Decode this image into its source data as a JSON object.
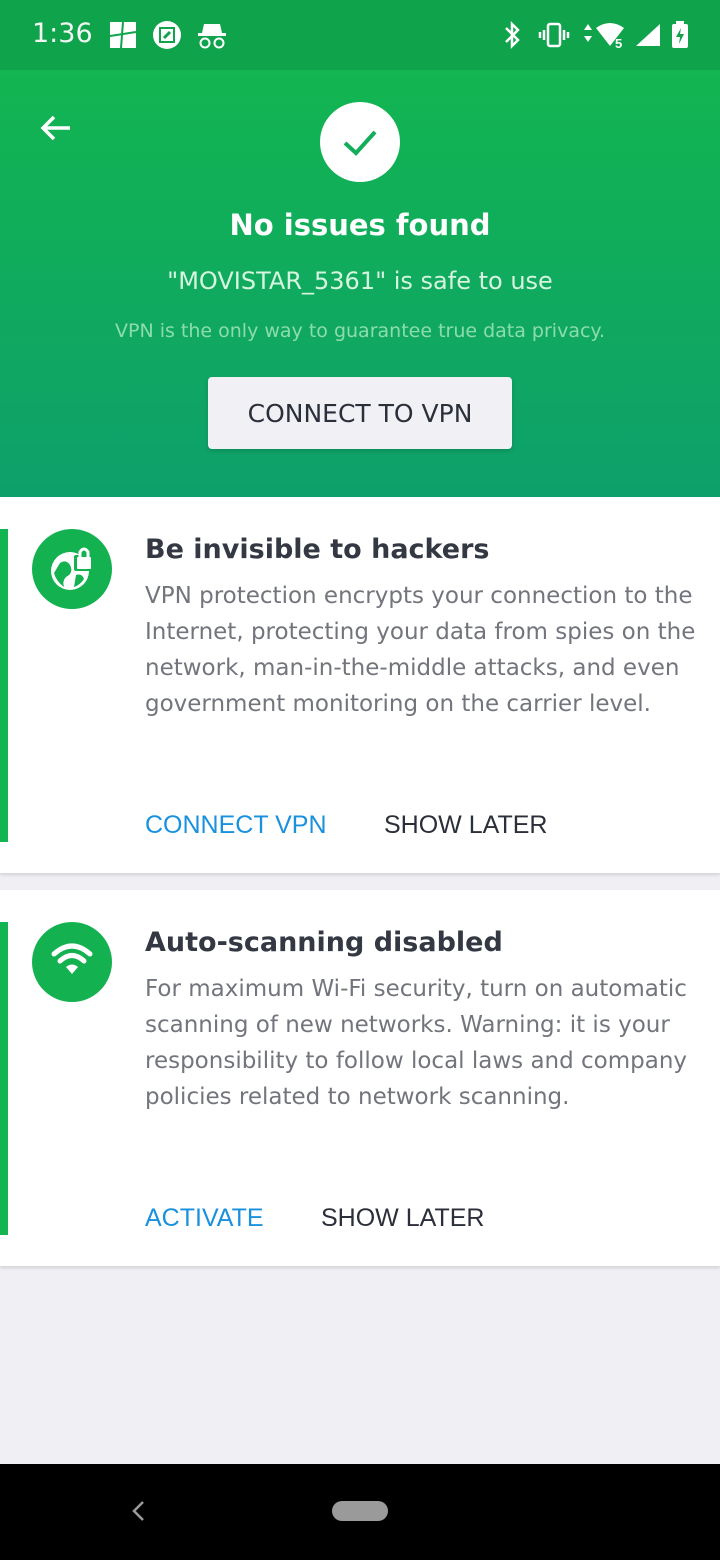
{
  "status_bar": {
    "time": "1:36",
    "left_icons": [
      "gallery-icon",
      "screenshot-edit-icon",
      "incognito-icon"
    ],
    "right_icons": [
      "bluetooth-icon",
      "vibrate-icon",
      "wifi-icon",
      "cell-signal-icon",
      "battery-charging-icon"
    ],
    "wifi_badge": "5"
  },
  "header": {
    "back_icon": "arrow-left-icon",
    "status_icon": "check-icon",
    "title": "No issues found",
    "subtitle": "\"MOVISTAR_5361\" is safe to use",
    "note": "VPN is the only way to guarantee true data privacy.",
    "cta_label": "CONNECT TO VPN"
  },
  "cards": [
    {
      "icon": "globe-lock-icon",
      "title": "Be invisible to hackers",
      "body": "VPN protection encrypts your connection to the Internet, protecting your data from spies on the network, man-in-the-middle attacks, and even government monitoring on the carrier level.",
      "primary_action": "CONNECT VPN",
      "secondary_action": "SHOW LATER"
    },
    {
      "icon": "wifi-icon",
      "title": "Auto-scanning disabled",
      "body": "For maximum Wi-Fi security, turn on automatic scanning of new networks. Warning: it is your responsibility to follow local laws and company policies related to network scanning.",
      "primary_action": "ACTIVATE",
      "secondary_action": "SHOW LATER"
    }
  ],
  "colors": {
    "brand_green": "#12b551",
    "link_blue": "#1a91de",
    "text_dark": "#2b2f3a"
  }
}
